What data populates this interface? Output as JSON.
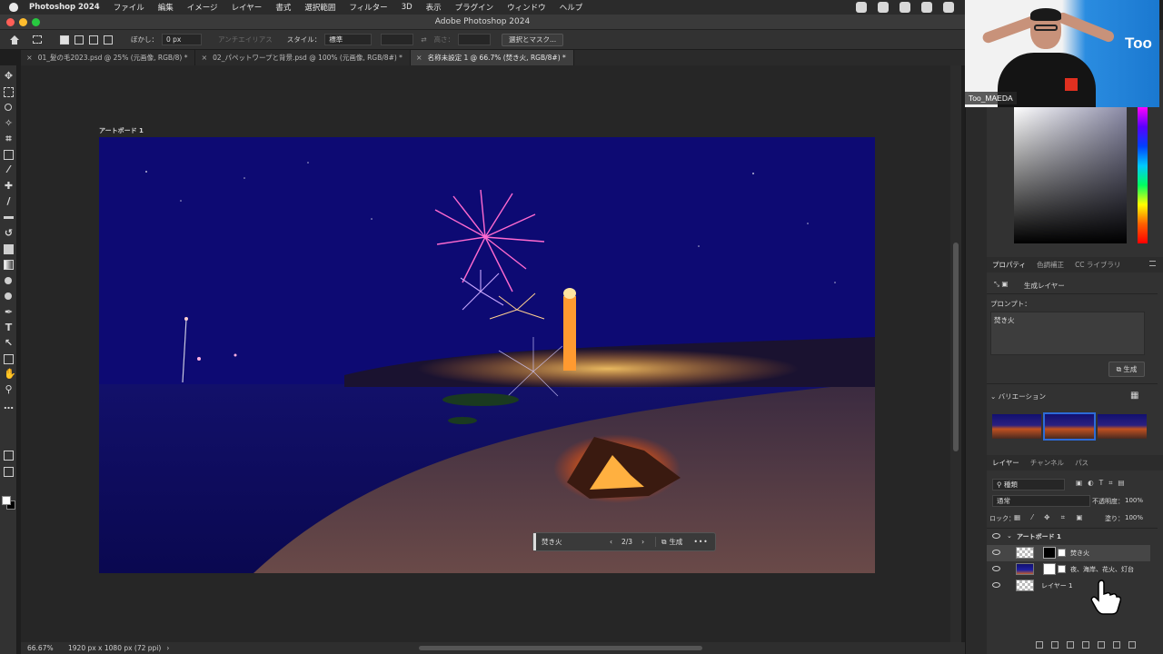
{
  "menubar": {
    "app": "Photoshop 2024",
    "items": [
      "ファイル",
      "編集",
      "イメージ",
      "レイヤー",
      "書式",
      "選択範囲",
      "フィルター",
      "3D",
      "表示",
      "プラグイン",
      "ウィンドウ",
      "ヘルプ"
    ]
  },
  "window": {
    "title": "Adobe Photoshop 2024"
  },
  "options": {
    "feather_label": "ぼかし：",
    "feather_value": "0 px",
    "antialias": "アンチエイリアス",
    "style_label": "スタイル：",
    "style_value": "標準",
    "height_label": "高さ：",
    "select_mask": "選択とマスク..."
  },
  "tabs": [
    {
      "label": "01_髪の毛2023.psd @ 25% (元画像, RGB/8) *"
    },
    {
      "label": "02_パペットワープと背景.psd @ 100% (元画像, RGB/8#) *"
    },
    {
      "label": "名称未設定 1 @ 66.7% (焚き火, RGB/8#) *"
    }
  ],
  "canvas": {
    "artboard_label": "アートボード 1"
  },
  "contextbar": {
    "prompt": "焚き火",
    "page": "2/3",
    "generate": "生成",
    "more": "•••"
  },
  "status": {
    "zoom": "66.67%",
    "doc_info": "1920 px x 1080 px (72 ppi)"
  },
  "properties": {
    "tabs": [
      "プロパティ",
      "色調補正",
      "CC ライブラリ"
    ],
    "layer_type": "生成レイヤー",
    "prompt_label": "プロンプト：",
    "prompt_value": "焚き火",
    "generate": "生成",
    "variations_label": "バリエーション"
  },
  "layers": {
    "tabs": [
      "レイヤー",
      "チャンネル",
      "パス"
    ],
    "filter": "種類",
    "blend_mode": "通常",
    "opacity_label": "不透明度：",
    "opacity_value": "100%",
    "lock_label": "ロック：",
    "fill_label": "塗り：",
    "fill_value": "100%",
    "group": "アートボード 1",
    "items": [
      {
        "name": "焚き火"
      },
      {
        "name": "夜、海岸、花火、灯台"
      },
      {
        "name": "レイヤー 1"
      }
    ]
  },
  "webcam": {
    "name": "Too_MAEDA",
    "brand": "Too"
  },
  "colors": {
    "accent": "#2d6bd8",
    "night_sky": "#0d0a73",
    "panel": "#323232"
  }
}
